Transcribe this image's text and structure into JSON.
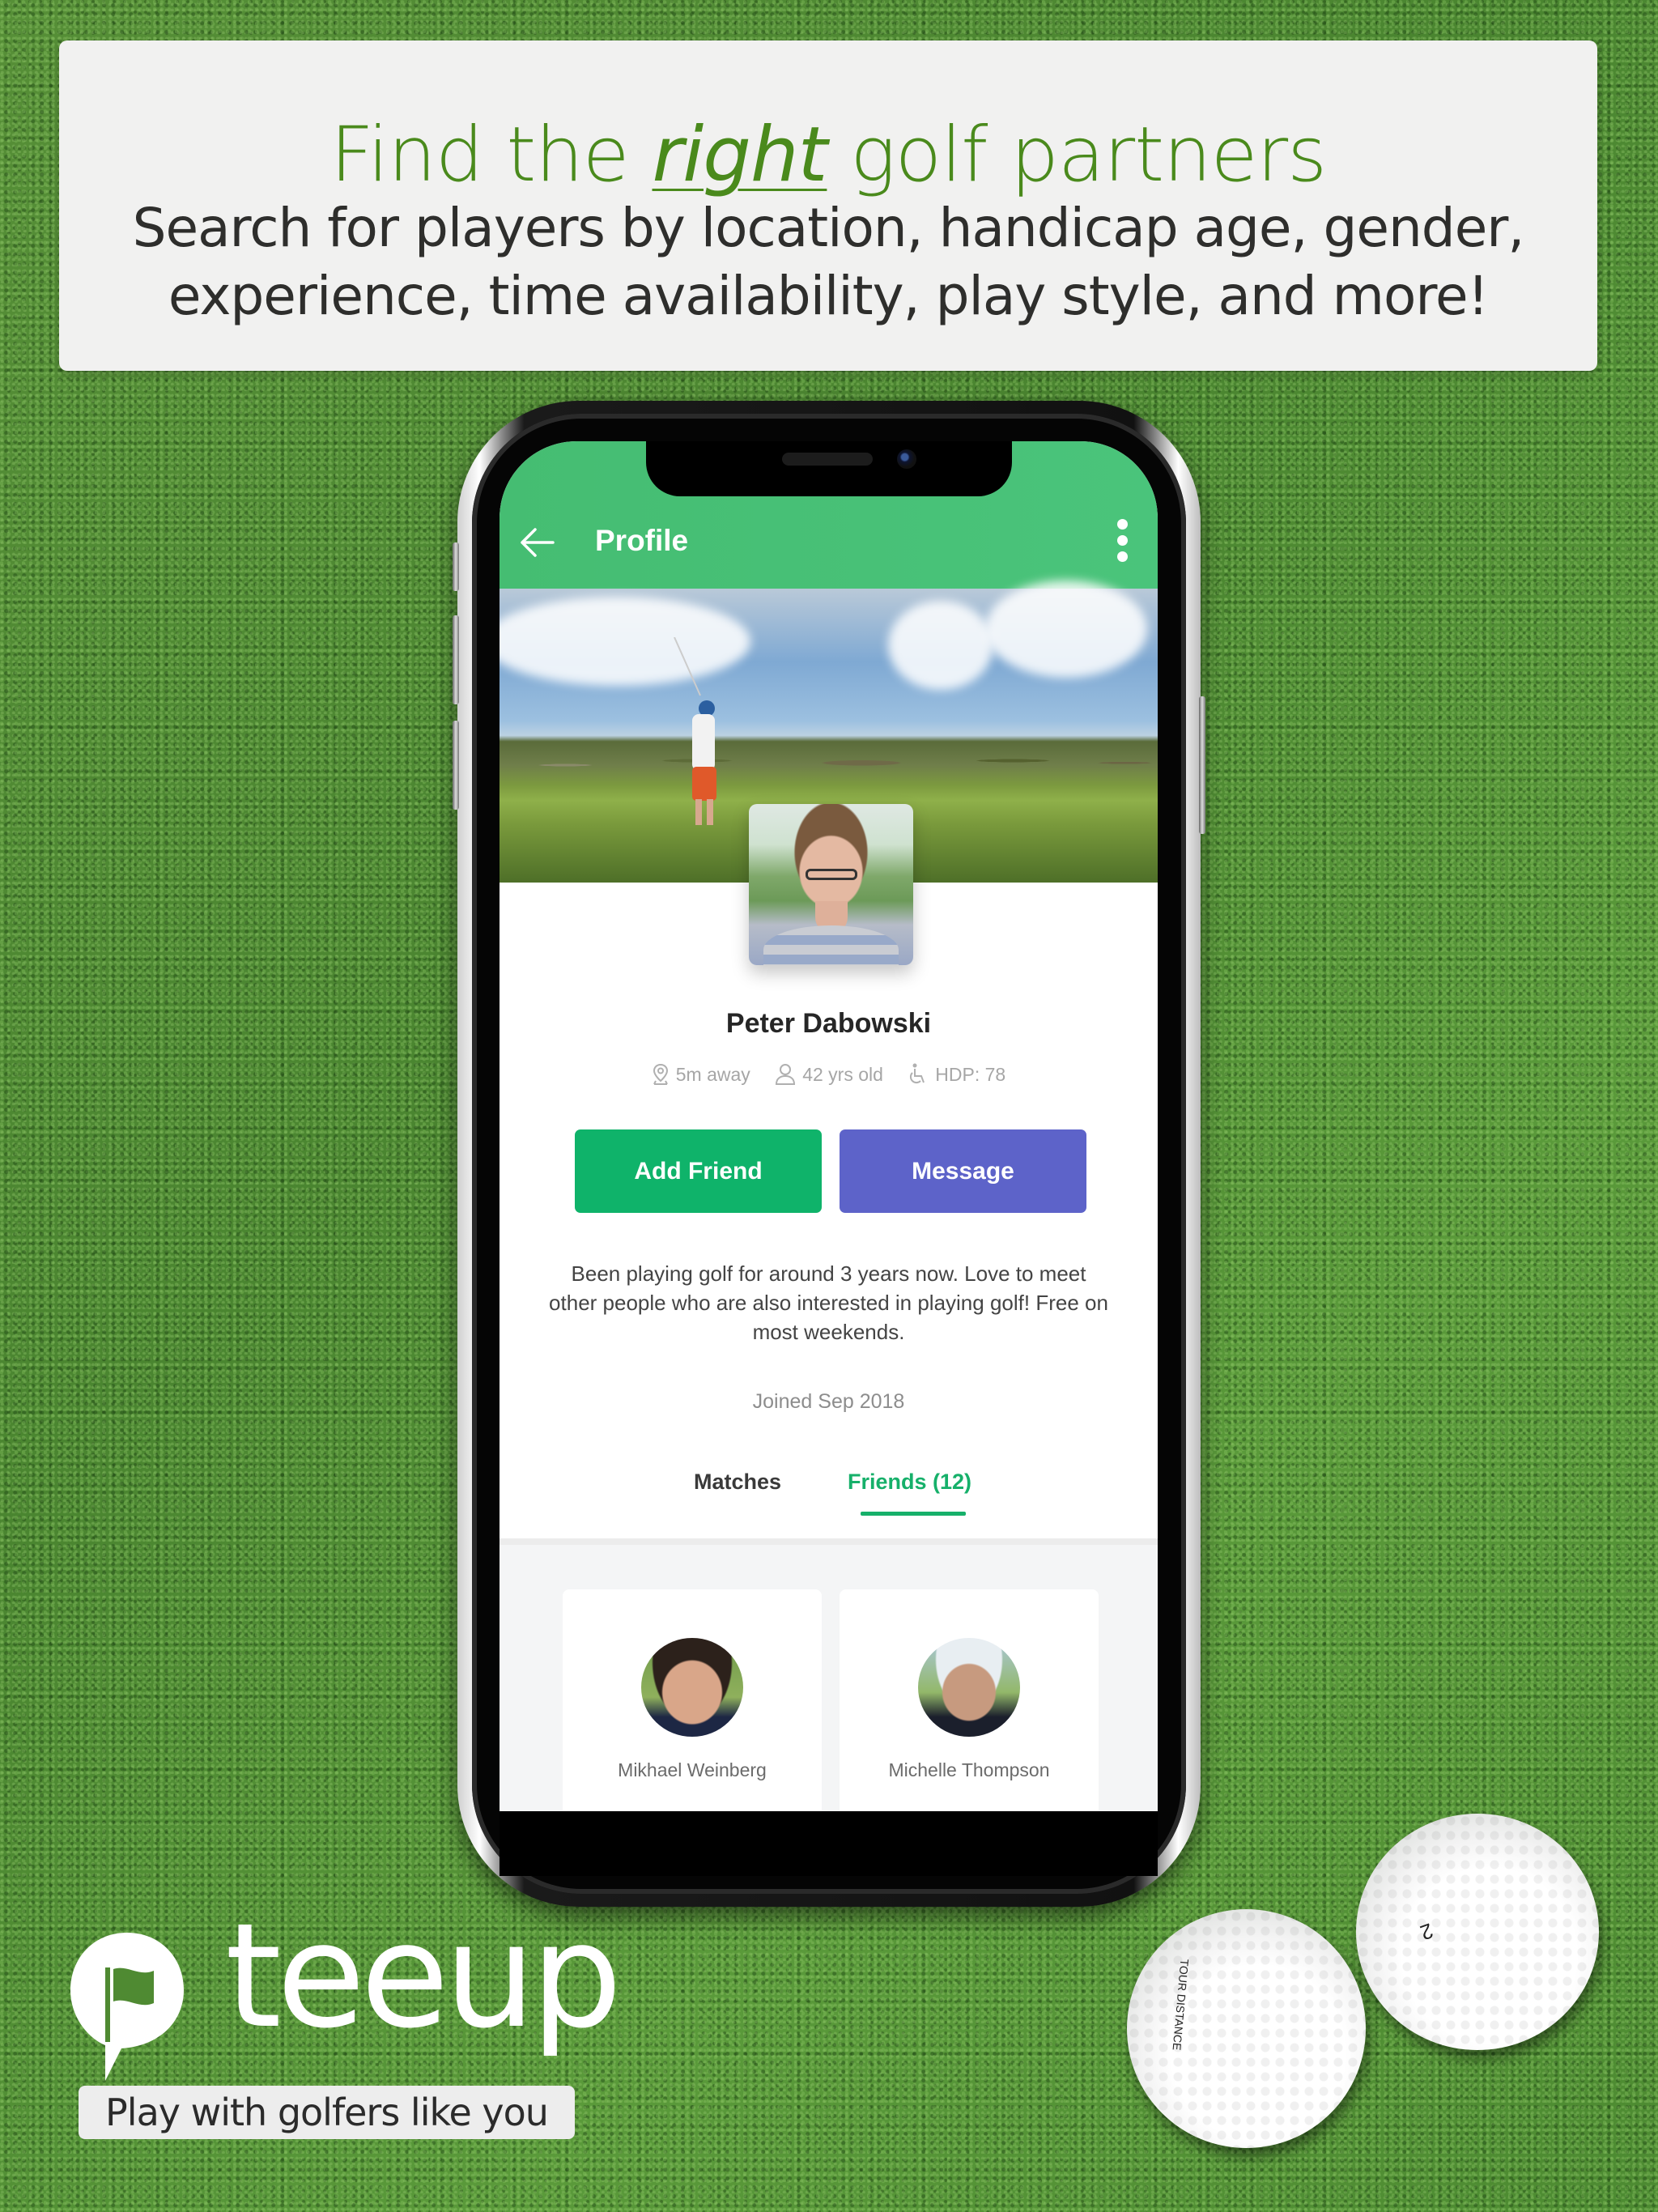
{
  "banner": {
    "headline_before": "Find the ",
    "headline_emphasis": "right",
    "headline_after": " golf partners",
    "subline_1": "Search for players by location, handicap age, gender,",
    "subline_2": "experience, time availability, play style, and more!",
    "headline_color": "#4a8a1c"
  },
  "app": {
    "header": {
      "back_icon": "arrow-left-icon",
      "title": "Profile",
      "menu_icon": "more-vertical-icon",
      "color": "#45bd72"
    },
    "profile": {
      "name": "Peter Dabowski",
      "stats": [
        {
          "icon": "location-pin-icon",
          "text": "5m away"
        },
        {
          "icon": "person-icon",
          "text": "42 yrs old"
        },
        {
          "icon": "handicap-icon",
          "text": "HDP: 78"
        }
      ],
      "bio": "Been playing golf for around 3 years now. Love to meet other people who are also interested in playing golf! Free on most weekends.",
      "joined": "Joined Sep 2018"
    },
    "actions": {
      "add_friend": "Add Friend",
      "message": "Message",
      "add_friend_color": "#0fb36a",
      "message_color": "#5d63c9"
    },
    "tabs": [
      {
        "label": "Matches",
        "active": false
      },
      {
        "label": "Friends (12)",
        "active": true
      }
    ],
    "friends": [
      {
        "name": "Mikhael Weinberg"
      },
      {
        "name": "Michelle Thompson"
      }
    ]
  },
  "branding": {
    "logo_text": "teeup",
    "tagline": "Play with golfers like you"
  },
  "golf_balls": {
    "ball_1_text": "TOUR DISTANCE",
    "ball_2_text": "2"
  }
}
